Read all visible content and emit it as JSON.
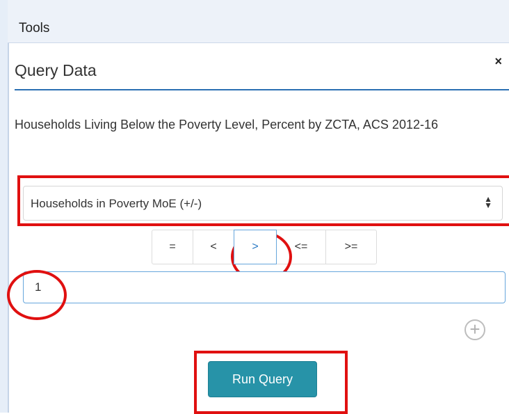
{
  "tools": {
    "title": "Tools"
  },
  "panel": {
    "title": "Query Data",
    "close_icon": "×",
    "description": "Households Living Below the Poverty Level, Percent by ZCTA, ACS 2012-16"
  },
  "query": {
    "field_select": {
      "selected": "Households in Poverty MoE (+/-)",
      "caret_icon": "⇕"
    },
    "operators": [
      {
        "label": "=",
        "active": false
      },
      {
        "label": "<",
        "active": false
      },
      {
        "label": ">",
        "active": true
      },
      {
        "label": "<=",
        "active": false
      },
      {
        "label": ">=",
        "active": false
      }
    ],
    "value_input": {
      "value": "1"
    },
    "add_icon": "+",
    "run_label": "Run Query"
  },
  "colors": {
    "accent": "#2a6fb3",
    "button": "#2793a8",
    "highlight": "#e01010"
  }
}
